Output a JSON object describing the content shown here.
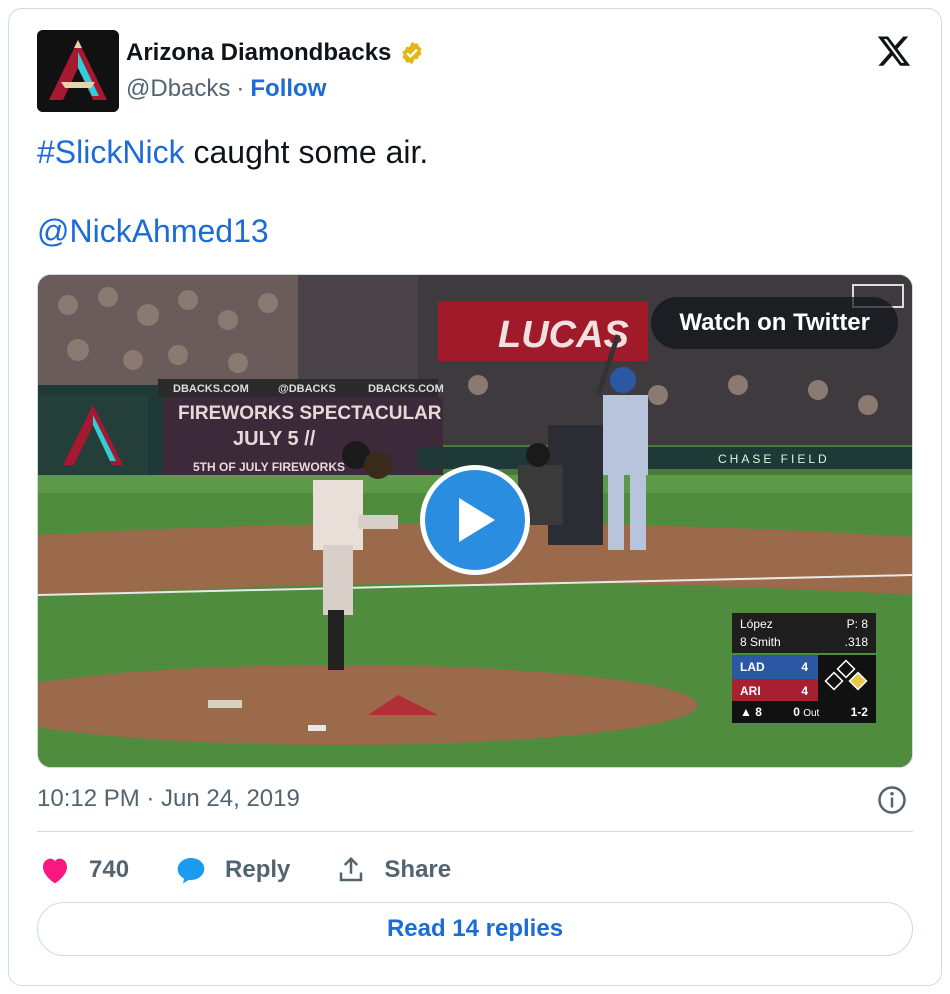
{
  "author": {
    "name": "Arizona Diamondbacks",
    "handle": "@Dbacks",
    "separator": "·",
    "follow_label": "Follow"
  },
  "tweet": {
    "hashtag": "#SlickNick",
    "text_rest": " caught some air.",
    "mention": "@NickAhmed13"
  },
  "media": {
    "watch_label": "Watch on Twitter",
    "scorebug": {
      "pitcher": "López",
      "pitch_count": "P: 8",
      "batter": "8 Smith",
      "batter_avg": ".318",
      "teams": [
        {
          "abbr": "LAD",
          "score": "4",
          "color": "#2c58a3"
        },
        {
          "abbr": "ARI",
          "score": "4",
          "color": "#a8202f"
        }
      ],
      "inning": "▲ 8",
      "outs": "0",
      "outs_label": "Out",
      "count": "1-2"
    },
    "signage": {
      "board_left_1": "DBACKS.COM",
      "board_left_2": "@DBACKS",
      "board_left_3": "DBACKS.COM",
      "fireworks_1": "FIREWORKS SPECTACULAR",
      "fireworks_2": "JULY 5 //",
      "fireworks_3": "5TH OF JULY FIREWORKS",
      "lucas": "LUCAS",
      "chase": "CHASE FIELD"
    }
  },
  "footer": {
    "timestamp": "10:12 PM · Jun 24, 2019",
    "likes_count": "740",
    "reply_label": "Reply",
    "share_label": "Share",
    "read_replies_label": "Read 14 replies"
  },
  "colors": {
    "link": "#1d6bd6",
    "like": "#f91880",
    "verified": "#e2b719",
    "play": "#2b8de0"
  }
}
